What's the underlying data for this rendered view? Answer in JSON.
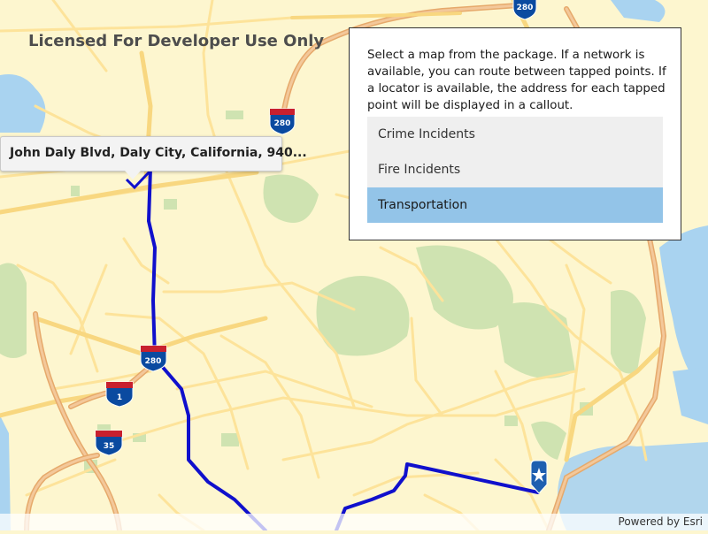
{
  "watermark": "Licensed For Developer Use Only",
  "callout": {
    "address": "John Daly Blvd, Daly City, California, 940..."
  },
  "panel": {
    "instructions": "Select a map from the package. If a network is available, you can route between tapped points. If a locator is available, the address for each tapped point will be displayed in a callout.",
    "maps": [
      {
        "label": "Crime Incidents",
        "selected": false
      },
      {
        "label": "Fire Incidents",
        "selected": false
      },
      {
        "label": "Transportation",
        "selected": true
      }
    ]
  },
  "shields": [
    {
      "label": "280"
    },
    {
      "label": "280"
    },
    {
      "label": "280"
    },
    {
      "label": "1"
    },
    {
      "label": "35"
    }
  ],
  "markers": {
    "destination_icon": "star-marker-icon"
  },
  "attribution": "Powered by Esri",
  "colors": {
    "route": "#1010cc",
    "selected_item": "#93c4e8",
    "map_background": "#fdf6cf",
    "park": "#cfe3b1",
    "water": "#a9d3f0"
  }
}
